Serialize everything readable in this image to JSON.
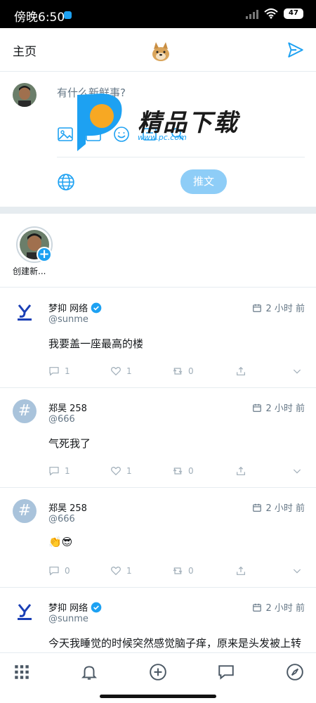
{
  "status_bar": {
    "time": "傍晚6:50",
    "battery": "47"
  },
  "header": {
    "title": "主页"
  },
  "composer": {
    "placeholder": "有什么新鲜事?",
    "post_label": "推文"
  },
  "watermark": {
    "title": "精品下载",
    "url": "www.pc.com"
  },
  "fleets": {
    "create_label": "创建新..."
  },
  "tweets": [
    {
      "name": "梦抑 网络",
      "handle": "@sunme",
      "time": "2 小时 前",
      "text": "我要盖一座最高的楼",
      "replies": "1",
      "likes": "1",
      "retweets": "0",
      "verified": true
    },
    {
      "name": "郑昊 258",
      "handle": "@666",
      "time": "2 小时 前",
      "text": "气死我了",
      "replies": "1",
      "likes": "1",
      "retweets": "0",
      "verified": false
    },
    {
      "name": "郑昊 258",
      "handle": "@666",
      "time": "2 小时 前",
      "text": "👏😎",
      "replies": "0",
      "likes": "1",
      "retweets": "0",
      "verified": false
    },
    {
      "name": "梦抑 网络",
      "handle": "@sunme",
      "time": "2 小时 前",
      "text": "今天我睡觉的时候突然感觉脑子痒，原来是头发被上转",
      "replies": "",
      "likes": "",
      "retweets": "",
      "verified": true
    }
  ],
  "colors": {
    "accent": "#1da1f2",
    "muted": "#657786",
    "divider": "#e6ecf0"
  }
}
